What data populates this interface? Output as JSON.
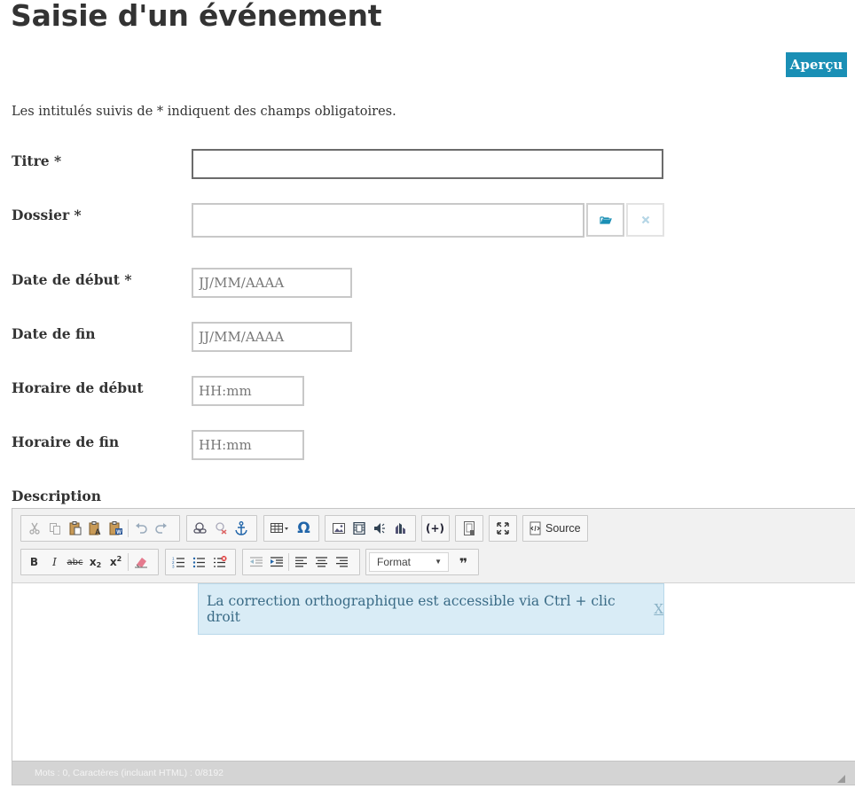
{
  "page": {
    "title": "Saisie d'un événement",
    "preview_label": "Aperçu",
    "intro": "Les intitulés suivis de * indiquent des champs obligatoires."
  },
  "form": {
    "title_label": "Titre *",
    "title_value": "",
    "folder_label": "Dossier *",
    "folder_value": "",
    "start_date_label": "Date de début *",
    "start_date_placeholder": "JJ/MM/AAAA",
    "end_date_label": "Date de fin",
    "end_date_placeholder": "JJ/MM/AAAA",
    "start_time_label": "Horaire de début",
    "start_time_placeholder": "HH:mm",
    "end_time_label": "Horaire de fin",
    "end_time_placeholder": "HH:mm",
    "description_label": "Description"
  },
  "editor": {
    "source_label": "Source",
    "format_label": "Format",
    "notice_text": "La correction orthographique est accessible via Ctrl + clic droit",
    "notice_close": "X",
    "counter": "Mots : 0, Caractères (incluant HTML) : 0/8192"
  },
  "colors": {
    "accent": "#1a8fb5",
    "notice_bg": "#d9ecf6",
    "notice_text": "#3a6b86"
  }
}
